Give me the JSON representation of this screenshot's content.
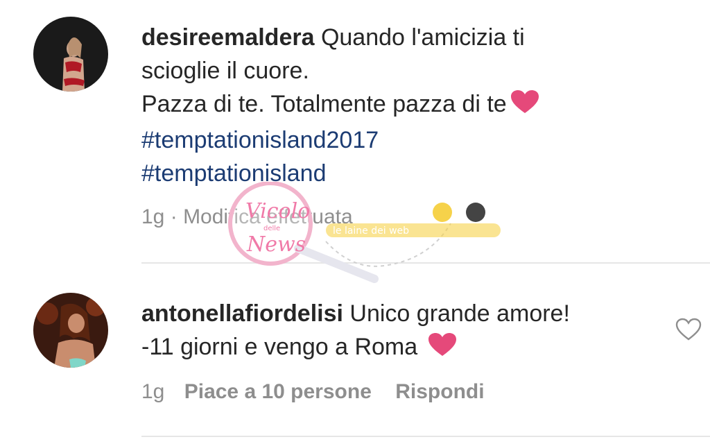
{
  "comments": [
    {
      "username": "desireemaldera",
      "lines": [
        "Quando l'amicizia ti",
        "scioglie il cuore.",
        "Pazza di te. Totalmente pazza di te"
      ],
      "hashtags": [
        "#temptationisland2017",
        "#temptationisland"
      ],
      "meta": {
        "time": "1g",
        "separator": "·",
        "edited": "Modifica effettuata"
      },
      "heart_color": "#e5497a"
    },
    {
      "username": "antonellafiordelisi",
      "lines": [
        "Unico grande amore!",
        "-11 giorni e vengo a Roma"
      ],
      "meta": {
        "time": "1g",
        "likes": "Piace a 10 persone",
        "reply": "Rispondi"
      },
      "heart_color": "#e5497a"
    }
  ],
  "watermark": {
    "logo_text": "Vicolo delle News",
    "side_text": "le laine dei web"
  },
  "icons": {
    "like": "heart-outline-icon",
    "emoji_heart": "pink-heart-emoji-icon"
  }
}
